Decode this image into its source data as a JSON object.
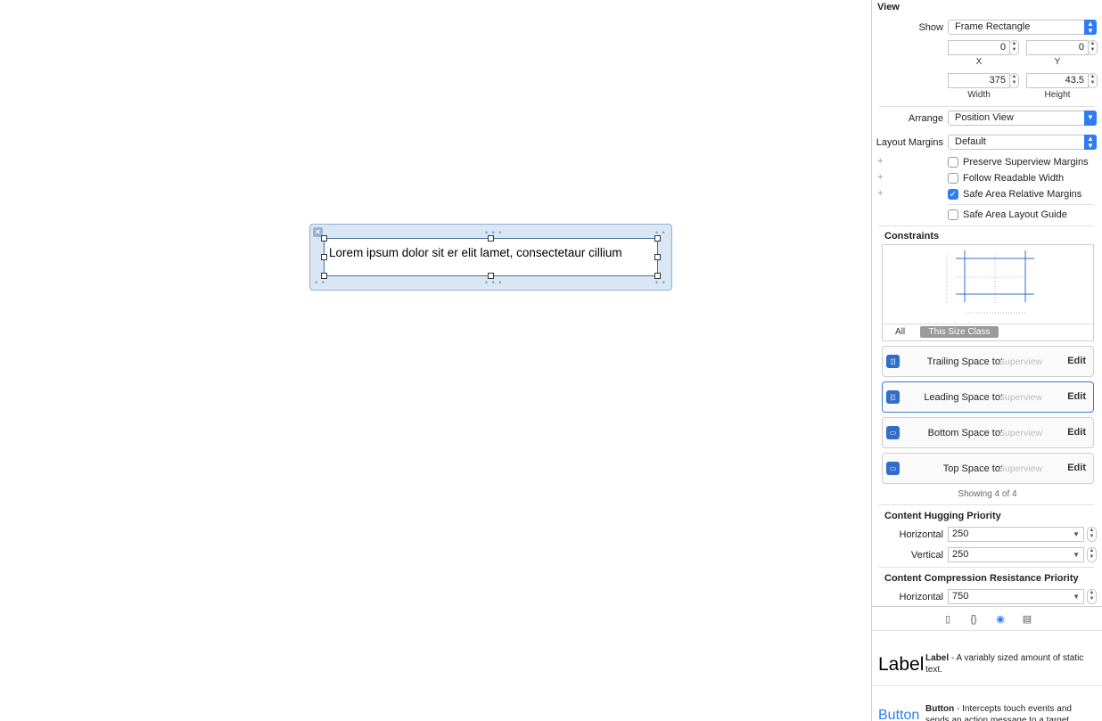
{
  "canvas": {
    "label_text": "Lorem ipsum dolor sit er elit lamet, consectetaur cillium"
  },
  "inspector": {
    "section_view": "View",
    "show_label": "Show",
    "show_value": "Frame Rectangle",
    "x_value": "0",
    "y_value": "0",
    "x_caption": "X",
    "y_caption": "Y",
    "width_value": "375",
    "height_value": "43.5",
    "width_caption": "Width",
    "height_caption": "Height",
    "arrange_label": "Arrange",
    "arrange_value": "Position View",
    "layout_margins_label": "Layout Margins",
    "layout_margins_value": "Default",
    "checkboxes": [
      {
        "label": "Preserve Superview Margins",
        "checked": false
      },
      {
        "label": "Follow Readable Width",
        "checked": false
      },
      {
        "label": "Safe Area Relative Margins",
        "checked": true
      },
      {
        "label": "Safe Area Layout Guide",
        "checked": false
      }
    ],
    "constraints_title": "Constraints",
    "seg_all": "All",
    "seg_size_class": "This Size Class",
    "constraints": [
      {
        "label": "Trailing Space to:",
        "target": "Superview",
        "edit": "Edit"
      },
      {
        "label": "Leading Space to:",
        "target": "Superview",
        "edit": "Edit"
      },
      {
        "label": "Bottom Space to:",
        "target": "Superview",
        "edit": "Edit"
      },
      {
        "label": "Top Space to:",
        "target": "Superview",
        "edit": "Edit"
      }
    ],
    "showing_text": "Showing 4 of 4",
    "hugging_title": "Content Hugging Priority",
    "hugging_h_label": "Horizontal",
    "hugging_h_value": "250",
    "hugging_v_label": "Vertical",
    "hugging_v_value": "250",
    "compression_title": "Content Compression Resistance Priority",
    "compression_h_label": "Horizontal",
    "compression_h_value": "750"
  },
  "library": {
    "items": [
      {
        "big": "Label",
        "name": "Label",
        "desc": " - A variably sized amount of static text."
      },
      {
        "big": "Button",
        "name": "Button",
        "desc": " - Intercepts touch events and sends an action message to a target"
      }
    ]
  },
  "colors": {
    "accent": "#2f7bf5",
    "selection_border": "#4a6f9b"
  }
}
